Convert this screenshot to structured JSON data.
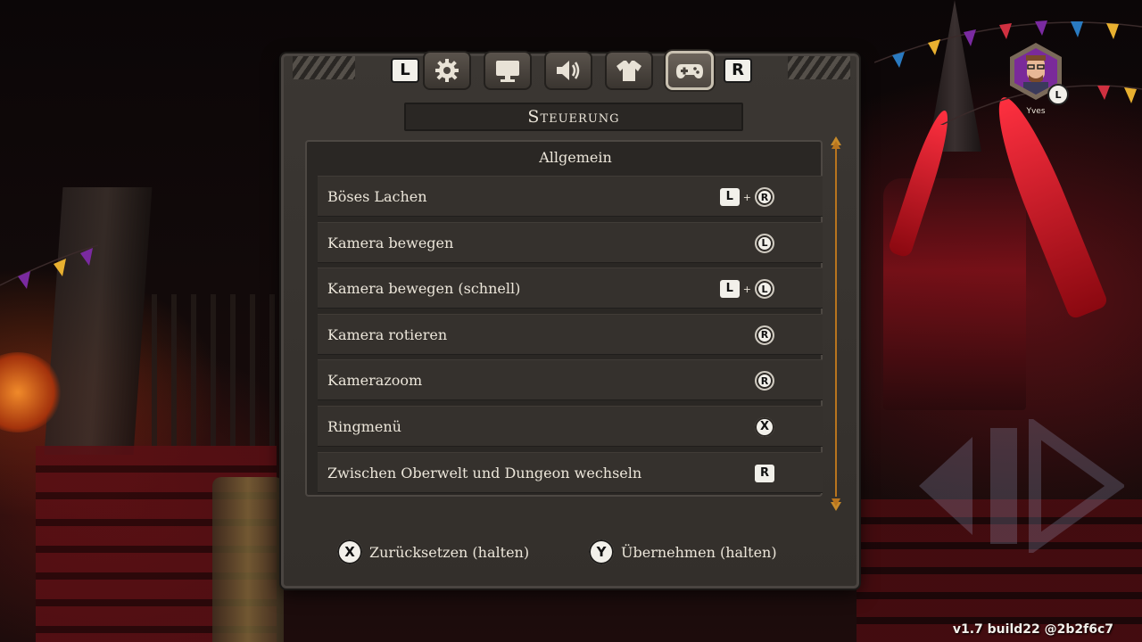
{
  "tabs": {
    "prev_hint": "L",
    "next_hint": "R",
    "items": [
      {
        "icon": "gear-icon",
        "active": false
      },
      {
        "icon": "monitor-icon",
        "active": false
      },
      {
        "icon": "speaker-icon",
        "active": false
      },
      {
        "icon": "shirt-icon",
        "active": false
      },
      {
        "icon": "gamepad-icon",
        "active": true
      }
    ]
  },
  "title": "Steuerung",
  "section": "Allgemein",
  "bindings": [
    {
      "label": "Böses Lachen",
      "keys": [
        {
          "type": "key",
          "text": "L"
        },
        {
          "type": "plus",
          "text": "+"
        },
        {
          "type": "stick",
          "text": "R"
        }
      ]
    },
    {
      "label": "Kamera bewegen",
      "keys": [
        {
          "type": "stick",
          "text": "L"
        }
      ]
    },
    {
      "label": "Kamera bewegen (schnell)",
      "keys": [
        {
          "type": "key",
          "text": "L"
        },
        {
          "type": "plus",
          "text": "+"
        },
        {
          "type": "stick",
          "text": "L"
        }
      ]
    },
    {
      "label": "Kamera rotieren",
      "keys": [
        {
          "type": "stick",
          "text": "R"
        }
      ]
    },
    {
      "label": "Kamerazoom",
      "keys": [
        {
          "type": "stick",
          "text": "R"
        }
      ]
    },
    {
      "label": "Ringmenü",
      "keys": [
        {
          "type": "round",
          "text": "X"
        }
      ]
    },
    {
      "label": "Zwischen Oberwelt und Dungeon wechseln",
      "keys": [
        {
          "type": "key",
          "text": "R"
        }
      ]
    }
  ],
  "footer": {
    "reset": {
      "button": "X",
      "label": "Zurücksetzen (halten)"
    },
    "apply": {
      "button": "Y",
      "label": "Übernehmen (halten)"
    }
  },
  "player": {
    "name": "Yves",
    "stick": "L"
  },
  "version": "v1.7 build22 @2b2f6c7",
  "colors": {
    "accent": "#b8741e",
    "panel": "#332f2b",
    "row": "#35312d"
  }
}
